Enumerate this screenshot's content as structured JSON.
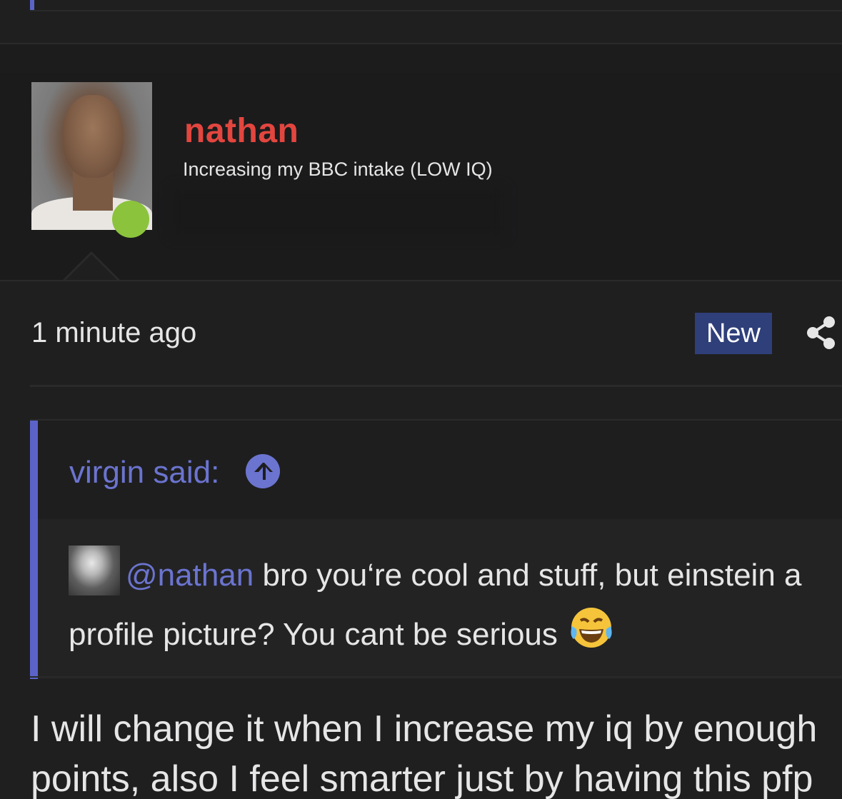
{
  "post": {
    "author": {
      "username": "nathan",
      "user_title": "Increasing my BBC intake (LOW IQ)",
      "online_status": "online",
      "username_color": "#e2463f",
      "online_color": "#8bc33c"
    },
    "time": "1 minute ago",
    "badge": "New",
    "share_icon": "share-icon",
    "quote": {
      "author_label": "virgin said:",
      "jump_icon": "arrow-up-circle-icon",
      "mention": "@nathan",
      "text_line1": " bro you‘re cool and stuff, but einstein a",
      "text_line2": "profile picture? You cant be serious",
      "emoji": "face-with-tears-of-joy"
    },
    "reply_line1": "I will change it when I increase my iq by enough",
    "reply_line2": "points, also I feel smarter just by having this pfp"
  },
  "colors": {
    "background": "#1f1f20",
    "accent": "#5b63c9",
    "link": "#6b74cf",
    "badge_bg": "#2f3f7a",
    "text": "#e6e6e6"
  }
}
